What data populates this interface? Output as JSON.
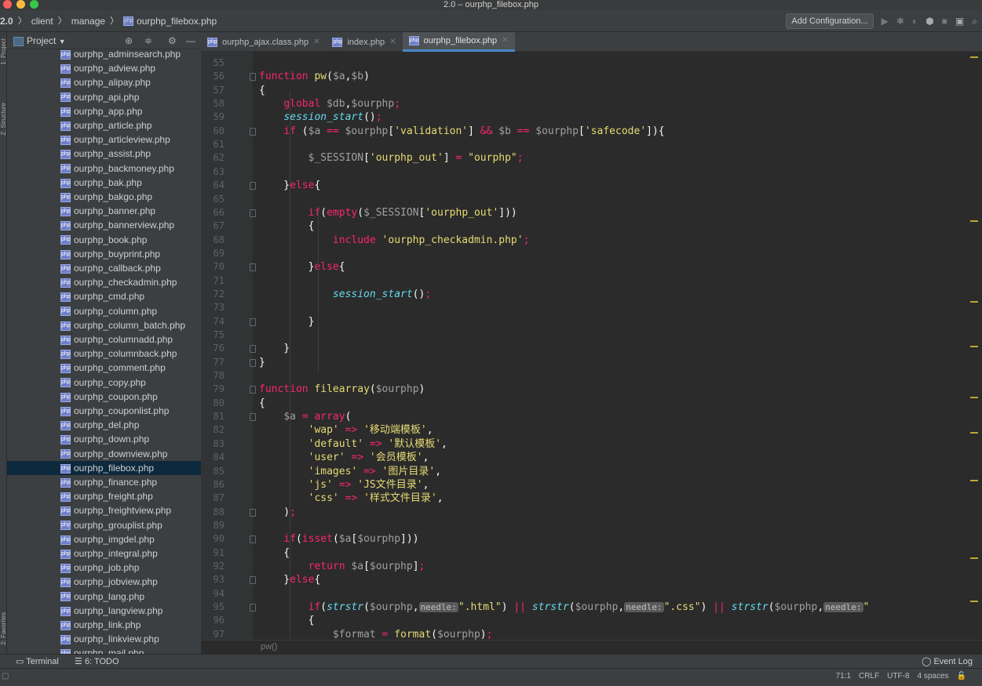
{
  "window": {
    "title": "2.0 – ourphp_filebox.php"
  },
  "breadcrumb": [
    "2.0",
    "client",
    "manage",
    "ourphp_filebox.php"
  ],
  "toolbar": {
    "add_config": "Add Configuration..."
  },
  "project": {
    "title": "Project",
    "dropdown_icon": "chevron-down-icon"
  },
  "left_strip": {
    "label1": "1: Project",
    "label2": "Z: Structure",
    "label3": "2: Favorites"
  },
  "tree": [
    "ourphp_adminsearch.php",
    "ourphp_adview.php",
    "ourphp_alipay.php",
    "ourphp_api.php",
    "ourphp_app.php",
    "ourphp_article.php",
    "ourphp_articleview.php",
    "ourphp_assist.php",
    "ourphp_backmoney.php",
    "ourphp_bak.php",
    "ourphp_bakgo.php",
    "ourphp_banner.php",
    "ourphp_bannerview.php",
    "ourphp_book.php",
    "ourphp_buyprint.php",
    "ourphp_callback.php",
    "ourphp_checkadmin.php",
    "ourphp_cmd.php",
    "ourphp_column.php",
    "ourphp_column_batch.php",
    "ourphp_columnadd.php",
    "ourphp_columnback.php",
    "ourphp_comment.php",
    "ourphp_copy.php",
    "ourphp_coupon.php",
    "ourphp_couponlist.php",
    "ourphp_del.php",
    "ourphp_down.php",
    "ourphp_downview.php",
    "ourphp_filebox.php",
    "ourphp_finance.php",
    "ourphp_freight.php",
    "ourphp_freightview.php",
    "ourphp_grouplist.php",
    "ourphp_imgdel.php",
    "ourphp_integral.php",
    "ourphp_job.php",
    "ourphp_jobview.php",
    "ourphp_lang.php",
    "ourphp_langview.php",
    "ourphp_link.php",
    "ourphp_linkview.php",
    "ourphp_mail.php"
  ],
  "tree_selected": "ourphp_filebox.php",
  "tabs": [
    "ourphp_ajax.class.php",
    "index.php",
    "ourphp_filebox.php"
  ],
  "active_tab": "ourphp_filebox.php",
  "code": [
    {
      "n": "55",
      "t": []
    },
    {
      "n": "56",
      "t": [
        [
          "kwr",
          "function "
        ],
        [
          "fn",
          "pw"
        ],
        [
          "pl",
          "("
        ],
        [
          "var",
          "$a"
        ],
        [
          "pl",
          ","
        ],
        [
          "var",
          "$b"
        ],
        [
          "pl",
          ")"
        ]
      ]
    },
    {
      "n": "57",
      "t": [
        [
          "pl",
          "{"
        ]
      ]
    },
    {
      "n": "58",
      "t": [
        [
          "pl",
          "    "
        ],
        [
          "kwr",
          "global "
        ],
        [
          "var",
          "$db"
        ],
        [
          "pl",
          ","
        ],
        [
          "var",
          "$ourphp"
        ],
        [
          "kwr",
          ";"
        ]
      ]
    },
    {
      "n": "59",
      "t": [
        [
          "pl",
          "    "
        ],
        [
          "ital",
          "session_start"
        ],
        [
          "pl",
          "()"
        ],
        [
          "kwr",
          ";"
        ]
      ]
    },
    {
      "n": "60",
      "t": [
        [
          "pl",
          "    "
        ],
        [
          "kwr",
          "if "
        ],
        [
          "pl",
          "("
        ],
        [
          "var",
          "$a"
        ],
        [
          "kwr",
          " == "
        ],
        [
          "var",
          "$ourphp"
        ],
        [
          "pl",
          "["
        ],
        [
          "str",
          "'validation'"
        ],
        [
          "pl",
          "] "
        ],
        [
          "kwr",
          "&& "
        ],
        [
          "var",
          "$b"
        ],
        [
          "kwr",
          " == "
        ],
        [
          "var",
          "$ourphp"
        ],
        [
          "pl",
          "["
        ],
        [
          "str",
          "'safecode'"
        ],
        [
          "pl",
          "]){"
        ]
      ]
    },
    {
      "n": "61",
      "t": []
    },
    {
      "n": "62",
      "t": [
        [
          "pl",
          "        "
        ],
        [
          "var",
          "$_SESSION"
        ],
        [
          "pl",
          "["
        ],
        [
          "str",
          "'ourphp_out'"
        ],
        [
          "pl",
          "] "
        ],
        [
          "kwr",
          "= "
        ],
        [
          "str",
          "\"ourphp\""
        ],
        [
          "kwr",
          ";"
        ]
      ]
    },
    {
      "n": "63",
      "t": []
    },
    {
      "n": "64",
      "t": [
        [
          "pl",
          "    }"
        ],
        [
          "kwr",
          "else"
        ],
        [
          "pl",
          "{"
        ]
      ]
    },
    {
      "n": "65",
      "t": []
    },
    {
      "n": "66",
      "t": [
        [
          "pl",
          "        "
        ],
        [
          "kwr",
          "if"
        ],
        [
          "pl",
          "("
        ],
        [
          "kwr",
          "empty"
        ],
        [
          "pl",
          "("
        ],
        [
          "var",
          "$_SESSION"
        ],
        [
          "pl",
          "["
        ],
        [
          "str",
          "'ourphp_out'"
        ],
        [
          "pl",
          "]))"
        ]
      ]
    },
    {
      "n": "67",
      "t": [
        [
          "pl",
          "        {"
        ]
      ]
    },
    {
      "n": "68",
      "t": [
        [
          "pl",
          "            "
        ],
        [
          "kwr",
          "include "
        ],
        [
          "str",
          "'ourphp_checkadmin.php'"
        ],
        [
          "kwr",
          ";"
        ]
      ]
    },
    {
      "n": "69",
      "t": []
    },
    {
      "n": "70",
      "t": [
        [
          "pl",
          "        }"
        ],
        [
          "kwr",
          "else"
        ],
        [
          "pl",
          "{"
        ]
      ]
    },
    {
      "n": "71",
      "t": []
    },
    {
      "n": "72",
      "t": [
        [
          "pl",
          "            "
        ],
        [
          "ital",
          "session_start"
        ],
        [
          "pl",
          "()"
        ],
        [
          "kwr",
          ";"
        ]
      ]
    },
    {
      "n": "73",
      "t": []
    },
    {
      "n": "74",
      "t": [
        [
          "pl",
          "        }"
        ]
      ]
    },
    {
      "n": "75",
      "t": []
    },
    {
      "n": "76",
      "t": [
        [
          "pl",
          "    }"
        ]
      ]
    },
    {
      "n": "77",
      "t": [
        [
          "pl",
          "}"
        ]
      ]
    },
    {
      "n": "78",
      "t": []
    },
    {
      "n": "79",
      "t": [
        [
          "kwr",
          "function "
        ],
        [
          "fn",
          "filearray"
        ],
        [
          "pl",
          "("
        ],
        [
          "var",
          "$ourphp"
        ],
        [
          "pl",
          ")"
        ]
      ]
    },
    {
      "n": "80",
      "t": [
        [
          "pl",
          "{"
        ]
      ]
    },
    {
      "n": "81",
      "t": [
        [
          "pl",
          "    "
        ],
        [
          "var",
          "$a"
        ],
        [
          "kwr",
          " = "
        ],
        [
          "kwr",
          "array"
        ],
        [
          "pl",
          "("
        ]
      ]
    },
    {
      "n": "82",
      "t": [
        [
          "pl",
          "        "
        ],
        [
          "str",
          "'wap'"
        ],
        [
          "kwr",
          " => "
        ],
        [
          "str",
          "'移动端模板'"
        ],
        [
          "pl",
          ","
        ]
      ]
    },
    {
      "n": "83",
      "t": [
        [
          "pl",
          "        "
        ],
        [
          "str",
          "'default'"
        ],
        [
          "kwr",
          " => "
        ],
        [
          "str",
          "'默认模板'"
        ],
        [
          "pl",
          ","
        ]
      ]
    },
    {
      "n": "84",
      "t": [
        [
          "pl",
          "        "
        ],
        [
          "str",
          "'user'"
        ],
        [
          "kwr",
          " => "
        ],
        [
          "str",
          "'会员模板'"
        ],
        [
          "pl",
          ","
        ]
      ]
    },
    {
      "n": "85",
      "t": [
        [
          "pl",
          "        "
        ],
        [
          "str",
          "'images'"
        ],
        [
          "kwr",
          " => "
        ],
        [
          "str",
          "'图片目录'"
        ],
        [
          "pl",
          ","
        ]
      ]
    },
    {
      "n": "86",
      "t": [
        [
          "pl",
          "        "
        ],
        [
          "str",
          "'js'"
        ],
        [
          "kwr",
          " => "
        ],
        [
          "str",
          "'JS文件目录'"
        ],
        [
          "pl",
          ","
        ]
      ]
    },
    {
      "n": "87",
      "t": [
        [
          "pl",
          "        "
        ],
        [
          "str",
          "'css'"
        ],
        [
          "kwr",
          " => "
        ],
        [
          "str",
          "'样式文件目录'"
        ],
        [
          "pl",
          ","
        ]
      ]
    },
    {
      "n": "88",
      "t": [
        [
          "pl",
          "    )"
        ],
        [
          "kwr",
          ";"
        ]
      ]
    },
    {
      "n": "89",
      "t": []
    },
    {
      "n": "90",
      "t": [
        [
          "pl",
          "    "
        ],
        [
          "kwr",
          "if"
        ],
        [
          "pl",
          "("
        ],
        [
          "kwr",
          "isset"
        ],
        [
          "pl",
          "("
        ],
        [
          "var",
          "$a"
        ],
        [
          "pl",
          "["
        ],
        [
          "var",
          "$ourphp"
        ],
        [
          "pl",
          "]))"
        ]
      ]
    },
    {
      "n": "91",
      "t": [
        [
          "pl",
          "    {"
        ]
      ]
    },
    {
      "n": "92",
      "t": [
        [
          "pl",
          "        "
        ],
        [
          "kwr",
          "return "
        ],
        [
          "var",
          "$a"
        ],
        [
          "pl",
          "["
        ],
        [
          "var",
          "$ourphp"
        ],
        [
          "pl",
          "]"
        ],
        [
          "kwr",
          ";"
        ]
      ]
    },
    {
      "n": "93",
      "t": [
        [
          "pl",
          "    }"
        ],
        [
          "kwr",
          "else"
        ],
        [
          "pl",
          "{"
        ]
      ]
    },
    {
      "n": "94",
      "t": []
    },
    {
      "n": "95",
      "t": [
        [
          "pl",
          "        "
        ],
        [
          "kwr",
          "if"
        ],
        [
          "pl",
          "("
        ],
        [
          "ital",
          "strstr"
        ],
        [
          "pl",
          "("
        ],
        [
          "var",
          "$ourphp"
        ],
        [
          "pl",
          ","
        ],
        [
          "hint",
          "needle:"
        ],
        [
          "str",
          "\".html\""
        ],
        [
          "pl",
          ") "
        ],
        [
          "kwr",
          "|| "
        ],
        [
          "ital",
          "strstr"
        ],
        [
          "pl",
          "("
        ],
        [
          "var",
          "$ourphp"
        ],
        [
          "pl",
          ","
        ],
        [
          "hint",
          "needle:"
        ],
        [
          "str",
          "\".css\""
        ],
        [
          "pl",
          ") "
        ],
        [
          "kwr",
          "|| "
        ],
        [
          "ital",
          "strstr"
        ],
        [
          "pl",
          "("
        ],
        [
          "var",
          "$ourphp"
        ],
        [
          "pl",
          ","
        ],
        [
          "hint",
          "needle:"
        ],
        [
          "str",
          "\""
        ]
      ]
    },
    {
      "n": "96",
      "t": [
        [
          "pl",
          "        {"
        ]
      ]
    },
    {
      "n": "97",
      "t": [
        [
          "pl",
          "            "
        ],
        [
          "var",
          "$format"
        ],
        [
          "kwr",
          " = "
        ],
        [
          "fn",
          "format"
        ],
        [
          "pl",
          "("
        ],
        [
          "var",
          "$ourphp"
        ],
        [
          "pl",
          ")"
        ],
        [
          "kwr",
          ";"
        ]
      ]
    }
  ],
  "function_breadcrumb": "pw()",
  "bottom_tools": {
    "terminal": "Terminal",
    "todo": "6: TODO",
    "event_log": "Event Log"
  },
  "status": {
    "position": "71:1",
    "line_sep": "CRLF",
    "encoding": "UTF-8",
    "indent": "4 spaces"
  },
  "colors": {
    "accent": "#4a88c7",
    "selected_row": "#0d293e",
    "keyword": "#f92672",
    "function": "#e6db74"
  }
}
